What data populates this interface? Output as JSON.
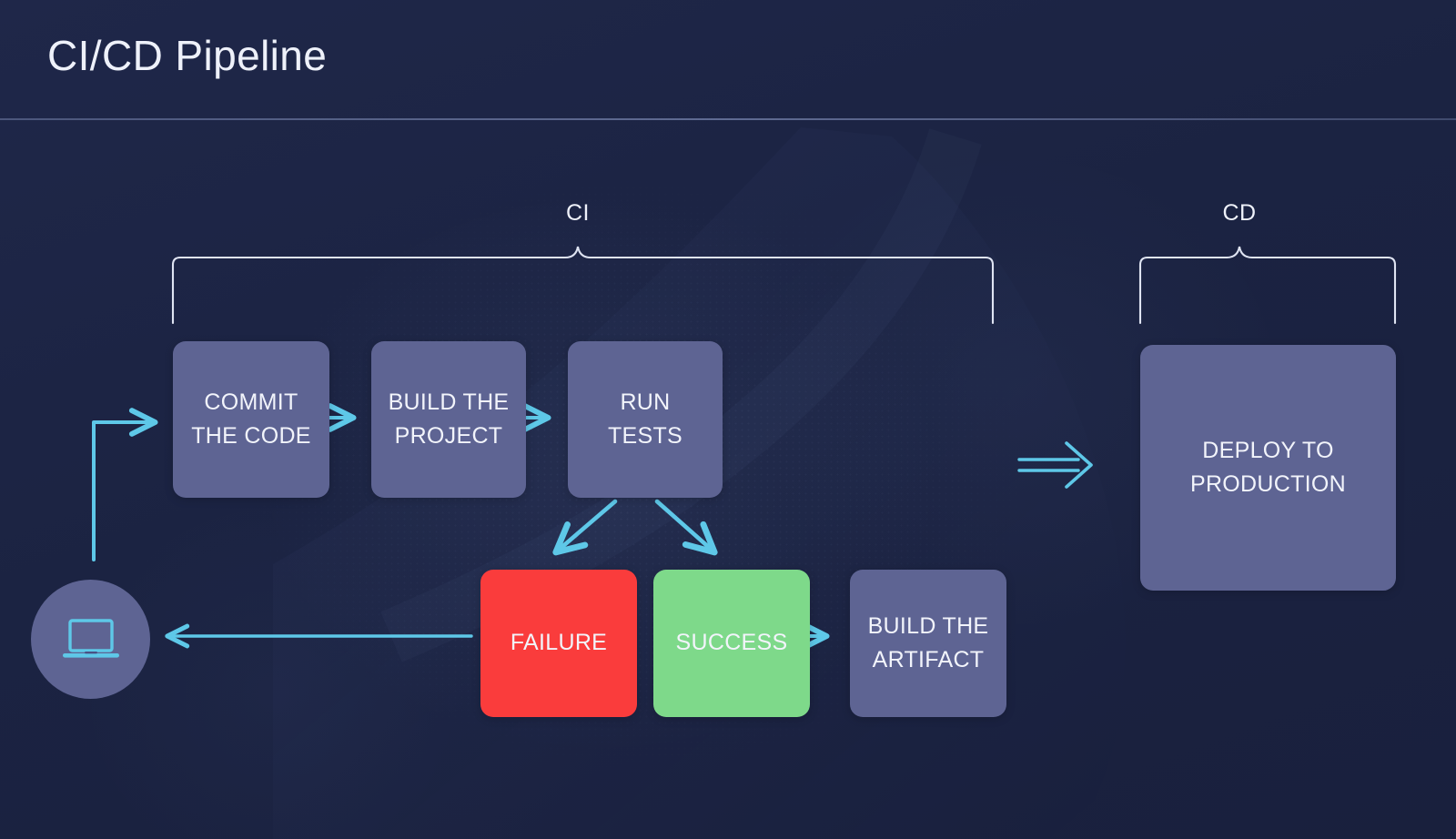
{
  "header": {
    "title": "CI/CD Pipeline"
  },
  "colors": {
    "background": "#1c2444",
    "step_node": "#5e6493",
    "failure_node": "#fa3c3c",
    "success_node": "#7ed98a",
    "arrow": "#5ec8e8",
    "brace": "#dfe4f2",
    "text": "#f2f4fb"
  },
  "diagram": {
    "type": "flowchart",
    "groups": [
      {
        "id": "ci",
        "label": "CI"
      },
      {
        "id": "cd",
        "label": "CD"
      }
    ],
    "actor": {
      "id": "developer",
      "icon": "laptop-icon"
    },
    "nodes": [
      {
        "id": "commit",
        "label_line1": "COMMIT",
        "label_line2": "THE CODE",
        "kind": "step"
      },
      {
        "id": "build",
        "label_line1": "BUILD THE",
        "label_line2": "PROJECT",
        "kind": "step"
      },
      {
        "id": "test",
        "label_line1": "RUN",
        "label_line2": "TESTS",
        "kind": "step"
      },
      {
        "id": "failure",
        "label_line1": "FAILURE",
        "label_line2": "",
        "kind": "failure"
      },
      {
        "id": "success",
        "label_line1": "SUCCESS",
        "label_line2": "",
        "kind": "success"
      },
      {
        "id": "artifact",
        "label_line1": "BUILD THE",
        "label_line2": "ARTIFACT",
        "kind": "step"
      },
      {
        "id": "deploy",
        "label_line1": "DEPLOY TO",
        "label_line2": "PRODUCTION",
        "kind": "step"
      }
    ],
    "edges": [
      {
        "from": "developer",
        "to": "commit",
        "style": "elbow"
      },
      {
        "from": "commit",
        "to": "build",
        "style": "arrow"
      },
      {
        "from": "build",
        "to": "test",
        "style": "arrow"
      },
      {
        "from": "test",
        "to": "failure",
        "style": "diagonal"
      },
      {
        "from": "test",
        "to": "success",
        "style": "diagonal"
      },
      {
        "from": "success",
        "to": "artifact",
        "style": "arrow"
      },
      {
        "from": "artifact",
        "to": "deploy",
        "style": "double-arrow"
      },
      {
        "from": "failure",
        "to": "developer",
        "style": "feedback"
      }
    ]
  }
}
